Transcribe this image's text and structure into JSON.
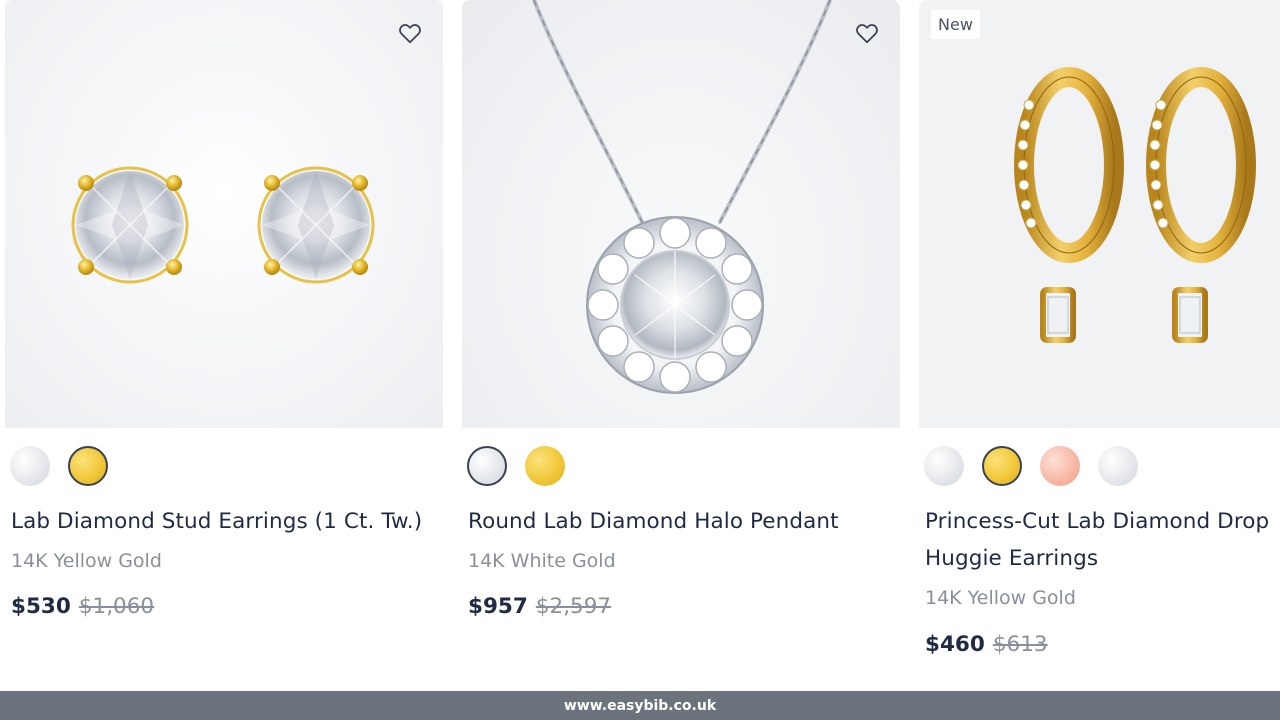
{
  "products": [
    {
      "title": "Lab Diamond Stud Earrings (1 Ct. Tw.)",
      "metal": "14K Yellow Gold",
      "price": "$530",
      "original_price": "$1,060",
      "swatches": [
        "white-gold",
        "yellow-gold"
      ],
      "selected_swatch": "yellow-gold",
      "wishlist_icon": "heart-outline-icon"
    },
    {
      "title": "Round Lab Diamond Halo Pendant",
      "metal": "14K White Gold",
      "price": "$957",
      "original_price": "$2,597",
      "swatches": [
        "white-gold",
        "yellow-gold"
      ],
      "selected_swatch": "white-gold",
      "wishlist_icon": "heart-outline-icon"
    },
    {
      "badge": "New",
      "title": "Princess-Cut Lab Diamond Drop Huggie Earrings",
      "metal": "14K Yellow Gold",
      "price": "$460",
      "original_price": "$613",
      "swatches": [
        "white-gold",
        "yellow-gold",
        "rose-gold",
        "platinum"
      ],
      "selected_swatch": "yellow-gold"
    }
  ],
  "footer": {
    "text": "www.easybib.co.uk"
  },
  "colors": {
    "title": "#1f2a44",
    "muted": "#8a909b",
    "yellow_gold": "#f1c83a",
    "rose_gold": "#f7b6a3",
    "white_gold": "#e3e6ea",
    "footer_bg": "#6c737c"
  }
}
